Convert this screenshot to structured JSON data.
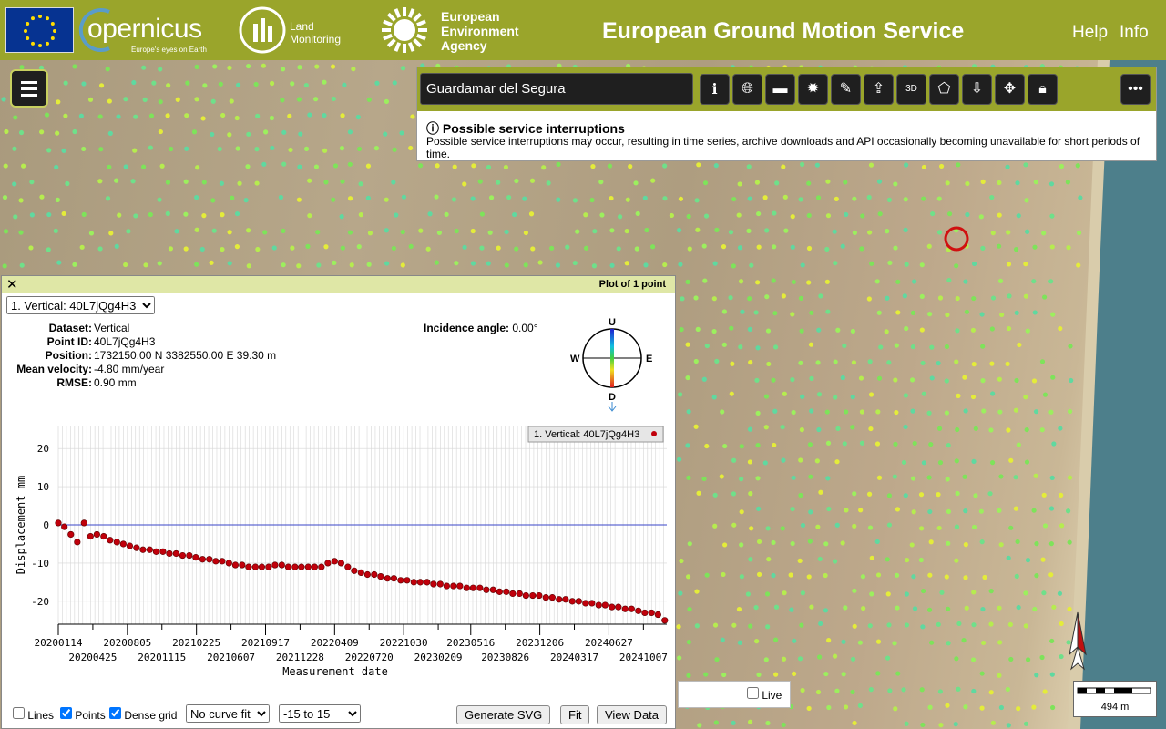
{
  "header": {
    "copernicus_logo": "opernicus",
    "copernicus_tagline": "Europe's eyes on Earth",
    "land_line1": "Land",
    "land_line2": "Monitoring",
    "eea_line1": "European",
    "eea_line2": "Environment",
    "eea_line3": "Agency",
    "title": "European Ground Motion Service",
    "help": "Help",
    "info": "Info"
  },
  "search": {
    "value": "Guardamar del Segura"
  },
  "toolbar": {
    "icons": [
      "info-icon",
      "globe-icon",
      "legend-bar-icon",
      "settings-sun-icon",
      "measure-icon",
      "share-icon",
      "3d-icon",
      "polygon-icon",
      "download-icon",
      "move-icon",
      "lock-icon",
      "more-icon"
    ],
    "three_d_label": "3D"
  },
  "notice": {
    "title": "Possible service interruptions",
    "body": "Possible service interruptions may occur, resulting in time series, archive downloads and API occasionally becoming unavailable for short periods of time."
  },
  "plot": {
    "header": "Plot of 1 point",
    "close": "✕",
    "series_select": "1. Vertical: 40L7jQg4H3",
    "info": [
      {
        "label": "Dataset:",
        "value": "Vertical"
      },
      {
        "label": "Point ID:",
        "value": "40L7jQg4H3"
      },
      {
        "label": "Position:",
        "value": "1732150.00 N 3382550.00 E 39.30 m"
      },
      {
        "label": "Mean velocity:",
        "value": "-4.80 mm/year"
      },
      {
        "label": "RMSE:",
        "value": "0.90 mm"
      }
    ],
    "incidence_label": "Incidence angle:",
    "incidence_value": "0.00°",
    "compass": {
      "u": "U",
      "d": "D",
      "w": "W",
      "e": "E"
    },
    "controls": {
      "lines": "Lines",
      "points": "Points",
      "dense_grid": "Dense grid",
      "lines_checked": false,
      "points_checked": true,
      "dense_grid_checked": true,
      "curve_fit": "No curve fit",
      "range": "-15 to 15",
      "generate_svg": "Generate SVG",
      "fit": "Fit",
      "view_data": "View Data"
    }
  },
  "live": {
    "label": "Live",
    "checked": false
  },
  "scale": {
    "label": "494 m"
  },
  "colors": {
    "header": "#9aa52b",
    "points": "#c0000b",
    "ref_line": "#3a46c8"
  },
  "chart_data": {
    "type": "scatter",
    "xlabel": "Measurement date",
    "ylabel": "Displacement mm",
    "ylim": [
      -26,
      26
    ],
    "yticks": [
      20,
      10,
      0,
      -10,
      -20
    ],
    "xticks_top": [
      "20200114",
      "20200805",
      "20210225",
      "20210917",
      "20220409",
      "20221030",
      "20230516",
      "20231206",
      "20240627"
    ],
    "xticks_bottom": [
      "20200425",
      "20201115",
      "20210607",
      "20211228",
      "20220720",
      "20230209",
      "20230826",
      "20240317",
      "20241007"
    ],
    "legend": "1. Vertical: 40L7jQg4H3",
    "legend_position": "top-right",
    "grid": true,
    "reference_line": 0,
    "x_start": "20200114",
    "x_end": "20241215",
    "series": [
      {
        "name": "1. Vertical: 40L7jQg4H3",
        "x": [
          "20200114",
          "20200201",
          "20200220",
          "20200310",
          "20200330",
          "20200418",
          "20200507",
          "20200527",
          "20200615",
          "20200705",
          "20200724",
          "20200812",
          "20200901",
          "20200920",
          "20201010",
          "20201029",
          "20201118",
          "20201207",
          "20201227",
          "20210115",
          "20210204",
          "20210223",
          "20210315",
          "20210404",
          "20210423",
          "20210512",
          "20210601",
          "20210620",
          "20210710",
          "20210729",
          "20210818",
          "20210906",
          "20210926",
          "20211015",
          "20211104",
          "20211123",
          "20211213",
          "20220101",
          "20220121",
          "20220209",
          "20220301",
          "20220320",
          "20220409",
          "20220428",
          "20220518",
          "20220606",
          "20220626",
          "20220715",
          "20220804",
          "20220823",
          "20220912",
          "20221001",
          "20221021",
          "20221109",
          "20221129",
          "20221218",
          "20230107",
          "20230126",
          "20230215",
          "20230306",
          "20230326",
          "20230414",
          "20230504",
          "20230523",
          "20230612",
          "20230701",
          "20230721",
          "20230809",
          "20230829",
          "20230917",
          "20231007",
          "20231026",
          "20231115",
          "20231204",
          "20231224",
          "20240112",
          "20240201",
          "20240220",
          "20240311",
          "20240330",
          "20240419",
          "20240508",
          "20240528",
          "20240616",
          "20240706",
          "20240725",
          "20240814",
          "20240902",
          "20240922",
          "20241011",
          "20241031",
          "20241119",
          "20241209"
        ],
        "y": [
          0.5,
          -0.5,
          -2.5,
          -4.5,
          0.5,
          -3,
          -2.5,
          -3,
          -4,
          -4.5,
          -5,
          -5.5,
          -6,
          -6.5,
          -6.5,
          -7,
          -7,
          -7.5,
          -7.5,
          -8,
          -8,
          -8.5,
          -9,
          -9,
          -9.5,
          -9.5,
          -10,
          -10.5,
          -10.5,
          -11,
          -11,
          -11,
          -11,
          -10.5,
          -10.5,
          -11,
          -11,
          -11,
          -11,
          -11,
          -11,
          -10,
          -9.5,
          -10,
          -11,
          -12,
          -12.5,
          -13,
          -13,
          -13.5,
          -14,
          -14,
          -14.5,
          -14.5,
          -15,
          -15,
          -15,
          -15.5,
          -15.5,
          -16,
          -16,
          -16,
          -16.5,
          -16.5,
          -16.5,
          -17,
          -17,
          -17.5,
          -17.5,
          -18,
          -18,
          -18.5,
          -18.5,
          -18.5,
          -19,
          -19,
          -19.5,
          -19.5,
          -20,
          -20,
          -20.5,
          -20.5,
          -21,
          -21,
          -21.5,
          -21.5,
          -22,
          -22,
          -22.5,
          -23,
          -23,
          -23.5,
          -25
        ]
      }
    ]
  }
}
